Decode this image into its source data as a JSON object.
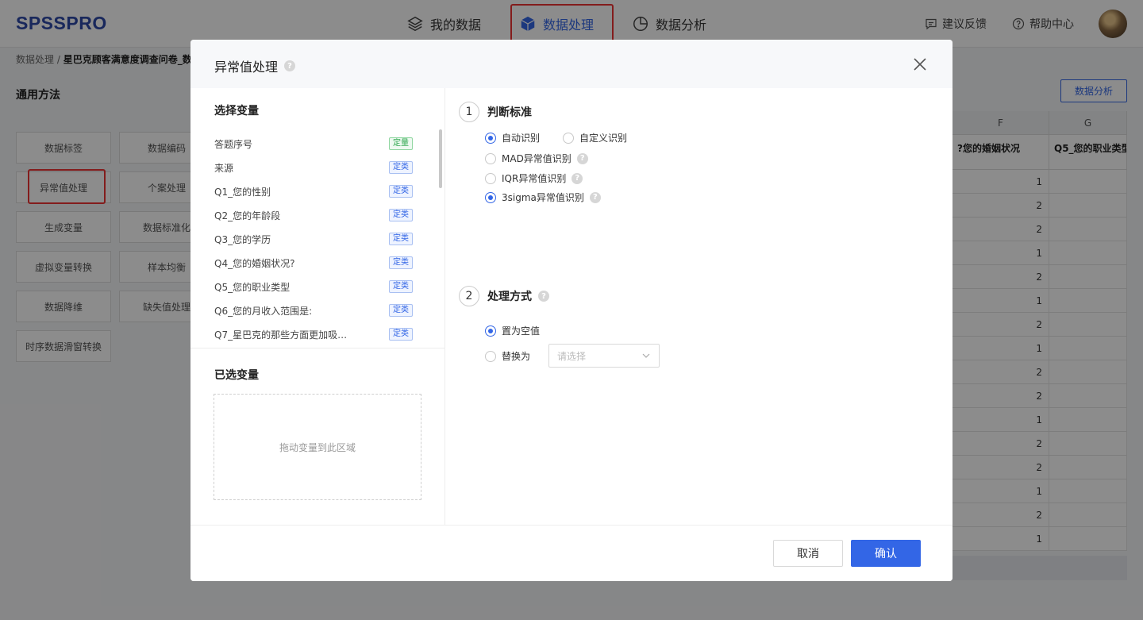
{
  "app": {
    "logo": "SPSSPRO"
  },
  "nav": {
    "tabs": [
      {
        "label": "我的数据",
        "icon": "layers-icon"
      },
      {
        "label": "数据处理",
        "icon": "cube-icon",
        "active": true
      },
      {
        "label": "数据分析",
        "icon": "pie-chart-icon"
      }
    ],
    "feedback": "建议反馈",
    "help": "帮助中心"
  },
  "background": {
    "breadcrumb_root": "数据处理",
    "breadcrumb_sep": "/",
    "breadcrumb_current": "星巴克顾客满意度调查问卷_数",
    "section_title": "通用方法",
    "methods": [
      [
        "数据标签",
        "数据编码"
      ],
      [
        "异常值处理",
        "个案处理"
      ],
      [
        "生成变量",
        "数据标准化"
      ],
      [
        "虚拟变量转换",
        "样本均衡"
      ],
      [
        "数据降维",
        "缺失值处理"
      ],
      [
        "时序数据滑窗转换"
      ]
    ],
    "analyze_button": "数据分析",
    "grid": {
      "columns": [
        "F",
        "G"
      ],
      "headers": [
        "您的婚姻状况?",
        "Q5_您的职业类型"
      ],
      "rows": [
        "1",
        "2",
        "2",
        "1",
        "2",
        "1",
        "2",
        "1",
        "2",
        "2",
        "1",
        "2",
        "2",
        "1",
        "2",
        "1"
      ]
    }
  },
  "modal": {
    "title": "异常值处理",
    "select_vars_title": "选择变量",
    "variables": [
      {
        "name": "答题序号",
        "tag": "定量"
      },
      {
        "name": "来源",
        "tag": "定类"
      },
      {
        "name": "Q1_您的性别",
        "tag": "定类"
      },
      {
        "name": "Q2_您的年龄段",
        "tag": "定类"
      },
      {
        "name": "Q3_您的学历",
        "tag": "定类"
      },
      {
        "name": "Q4_您的婚姻状况?",
        "tag": "定类"
      },
      {
        "name": "Q5_您的职业类型",
        "tag": "定类"
      },
      {
        "name": "Q6_您的月收入范围是:",
        "tag": "定类"
      },
      {
        "name": "Q7_星巴克的那些方面更加吸…",
        "tag": "定类"
      }
    ],
    "selected_vars_title": "已选变量",
    "dropzone_text": "拖动变量到此区域",
    "step1": {
      "num": "1",
      "title": "判断标准",
      "auto": "自动识别",
      "custom": "自定义识别",
      "options": [
        "MAD异常值识别",
        "IQR异常值识别",
        "3sigma异常值识别"
      ],
      "selected": "3sigma异常值识别"
    },
    "step2": {
      "num": "2",
      "title": "处理方式",
      "set_null": "置为空值",
      "replace": "替换为",
      "replace_placeholder": "请选择"
    },
    "cancel": "取消",
    "confirm": "确认"
  }
}
